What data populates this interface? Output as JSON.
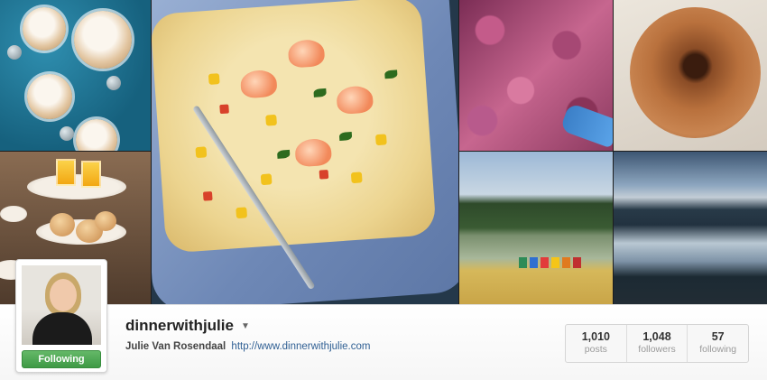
{
  "profile": {
    "username": "dinnerwithjulie",
    "full_name": "Julie Van Rosendaal",
    "website": "http://www.dinnerwithjulie.com",
    "follow_button_label": "Following",
    "follow_button_color": "#4caf50"
  },
  "stats": [
    {
      "value": "1,010",
      "label": "posts"
    },
    {
      "value": "1,048",
      "label": "followers"
    },
    {
      "value": "57",
      "label": "following"
    }
  ],
  "mosaic": {
    "tiles": [
      {
        "subject": "muffins"
      },
      {
        "subject": "seafood-corn-chowder"
      },
      {
        "subject": "autumn-leaves"
      },
      {
        "subject": "donut"
      },
      {
        "subject": "high-tea-stand"
      },
      {
        "subject": "lake-with-colorful-chairs"
      },
      {
        "subject": "lake-at-dusk"
      }
    ]
  },
  "icons": {
    "dropdown": "chevron-down-icon"
  }
}
